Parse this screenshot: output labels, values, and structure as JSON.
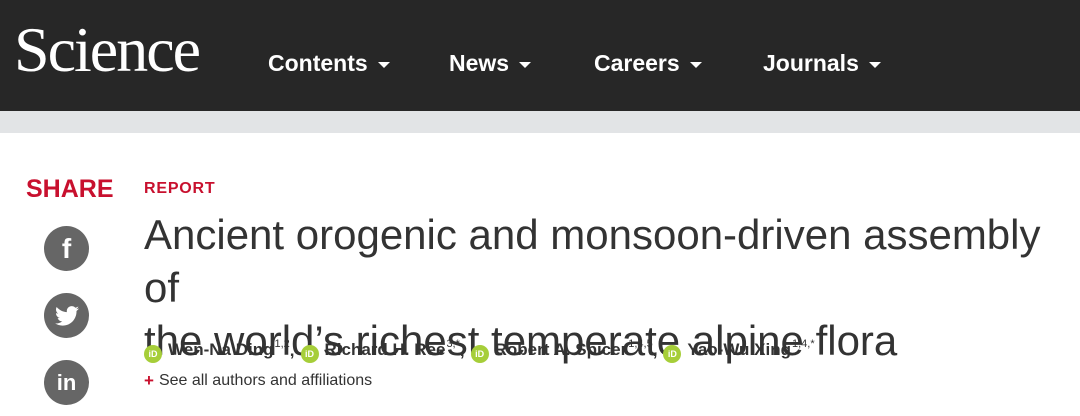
{
  "header": {
    "logo": "Science",
    "nav": [
      {
        "label": "Contents"
      },
      {
        "label": "News"
      },
      {
        "label": "Careers"
      },
      {
        "label": "Journals"
      }
    ]
  },
  "share": {
    "label": "SHARE",
    "buttons": [
      {
        "icon": "facebook-icon",
        "glyph": "f"
      },
      {
        "icon": "twitter-icon"
      },
      {
        "icon": "linkedin-icon",
        "glyph": "in"
      }
    ]
  },
  "article": {
    "type": "REPORT",
    "title_line1": "Ancient orogenic and monsoon-driven assembly of",
    "title_line2": "the world’s richest temperate alpine flora",
    "authors": [
      {
        "name": "Wen-Na Ding",
        "sup": "1,2",
        "sep": ","
      },
      {
        "name": "Richard H. Ree",
        "sup": "3,*",
        "sep": ","
      },
      {
        "name": "Robert A. Spicer",
        "sup": "1,4,5",
        "sep": ","
      },
      {
        "name": "Yao-Wu Xing",
        "sup": "1,4,*",
        "sep": ""
      }
    ],
    "orcid_glyph": "iD",
    "see_all_plus": "+",
    "see_all_label": "See all authors and affiliations"
  },
  "colors": {
    "header_bg": "#272727",
    "accent_red": "#c8102e",
    "orcid_green": "#a6ce39",
    "social_grey": "#666666"
  }
}
